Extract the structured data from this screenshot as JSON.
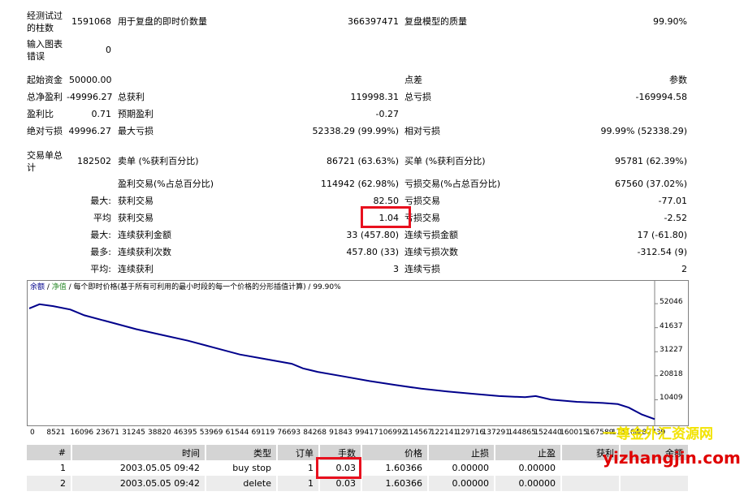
{
  "stats": {
    "bars_label": "经测试过的柱数",
    "bars_value": "1591068",
    "ticks_label": "用于复盘的即时价数量",
    "ticks_value": "366397471",
    "quality_label": "复盘模型的质量",
    "quality_value": "99.90%",
    "mismatch_label": "输入图表错误",
    "mismatch_value": "0",
    "deposit_label": "起始资金",
    "deposit_value": "50000.00",
    "spread_label": "点差",
    "spread_value": "参数",
    "net_profit_label": "总净盈利",
    "net_profit_value": "-49996.27",
    "gross_profit_label": "总获利",
    "gross_profit_value": "119998.31",
    "gross_loss_label": "总亏损",
    "gross_loss_value": "-169994.58",
    "profit_factor_label": "盈利比",
    "profit_factor_value": "0.71",
    "expected_payoff_label": "预期盈利",
    "expected_payoff_value": "-0.27",
    "abs_drawdown_label": "绝对亏损",
    "abs_drawdown_value": "49996.27",
    "max_drawdown_label": "最大亏损",
    "max_drawdown_value": "52338.29 (99.99%)",
    "rel_drawdown_label": "相对亏损",
    "rel_drawdown_value": "99.99% (52338.29)",
    "total_trades_label": "交易单总计",
    "total_trades_value": "182502",
    "short_label": "卖单 (%获利百分比)",
    "short_value": "86721 (63.63%)",
    "long_label": "买单 (%获利百分比)",
    "long_value": "95781 (62.39%)",
    "profit_trades_label": "盈利交易(%占总百分比)",
    "profit_trades_value": "114942 (62.98%)",
    "loss_trades_label": "亏损交易(%占总百分比)",
    "loss_trades_value": "67560 (37.02%)",
    "largest_label": "最大:",
    "largest_profit_label": "获利交易",
    "largest_profit_value": "82.50",
    "largest_loss_label": "亏损交易",
    "largest_loss_value": "-77.01",
    "average_label": "平均",
    "average_profit_label": "获利交易",
    "average_profit_value": "1.04",
    "average_loss_label": "亏损交易",
    "average_loss_value": "-2.52",
    "max_label": "最大:",
    "max_consec_wins_money_label": "连续获利金额",
    "max_consec_wins_money_value": "33 (457.80)",
    "max_consec_loss_money_label": "连续亏损金额",
    "max_consec_loss_money_value": "17 (-61.80)",
    "most_label": "最多:",
    "max_consec_profit_count_label": "连续获利次数",
    "max_consec_profit_count_value": "457.80 (33)",
    "max_consec_loss_count_label": "连续亏损次数",
    "max_consec_loss_count_value": "-312.54 (9)",
    "avg_label": "平均:",
    "avg_consec_wins_label": "连续获利",
    "avg_consec_wins_value": "3",
    "avg_consec_losses_label": "连续亏损",
    "avg_consec_losses_value": "2"
  },
  "chart_data": {
    "type": "line",
    "legend_balance": "余额",
    "legend_sep": " / ",
    "legend_equity": "净值",
    "legend_rest": " / 每个即时价格(基于所有可利用的最小时段的每一个价格的分形插值计算) / 99.90%",
    "x_ticks": [
      "0",
      "8521",
      "16096",
      "23671",
      "31245",
      "38820",
      "46395",
      "53969",
      "61544",
      "69119",
      "76693",
      "84268",
      "91843",
      "99417",
      "106992",
      "114567",
      "122141",
      "129716",
      "137291",
      "144865",
      "152440",
      "160015",
      "167589",
      "175164",
      "182739"
    ],
    "y_ticks": [
      52046,
      41637,
      31227,
      20818,
      10409
    ],
    "ylim": [
      0,
      57000
    ],
    "xlim": [
      0,
      182739
    ],
    "series": [
      {
        "color": "#00008b",
        "x": [
          0,
          3000,
          7000,
          12000,
          16096,
          23671,
          31245,
          38820,
          46395,
          53969,
          61544,
          69119,
          76693,
          80000,
          84268,
          91843,
          99417,
          106992,
          114567,
          122141,
          129716,
          137291,
          144865,
          148000,
          152440,
          160015,
          167589,
          172000,
          175164,
          179000,
          182739
        ],
        "y": [
          50000,
          51800,
          51000,
          49500,
          47000,
          44000,
          41000,
          38500,
          36000,
          33000,
          30000,
          28000,
          26000,
          24000,
          22500,
          20500,
          18500,
          16800,
          15200,
          14000,
          13000,
          12000,
          11500,
          12000,
          10500,
          9500,
          9000,
          8500,
          7000,
          4000,
          2000
        ]
      }
    ]
  },
  "table": {
    "headers": [
      "#",
      "时间",
      "类型",
      "订单",
      "手数",
      "价格",
      "止损",
      "止盈",
      "获利",
      "余额"
    ],
    "rows": [
      [
        "1",
        "2003.05.05 09:42",
        "buy stop",
        "1",
        "0.03",
        "1.60366",
        "0.00000",
        "0.00000",
        "",
        ""
      ],
      [
        "2",
        "2003.05.05 09:42",
        "delete",
        "1",
        "0.03",
        "1.60366",
        "0.00000",
        "0.00000",
        "",
        ""
      ]
    ]
  },
  "watermark": {
    "line1": "一尊金外汇资源网",
    "line2": "yizhangjin.com",
    "color1": "#f2e300",
    "color2": "#e00000"
  }
}
